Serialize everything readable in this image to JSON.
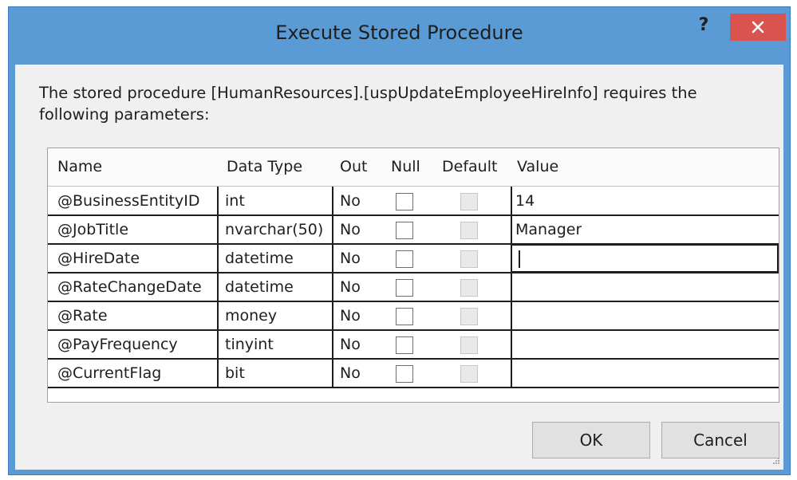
{
  "window": {
    "title": "Execute Stored Procedure",
    "help_label": "?",
    "accent_color": "#5b9bd5",
    "close_color": "#d9534f"
  },
  "description": "The stored procedure [HumanResources].[uspUpdateEmployeeHireInfo] requires the following parameters:",
  "grid": {
    "headers": {
      "name": "Name",
      "datatype": "Data Type",
      "out": "Out",
      "null": "Null",
      "default": "Default",
      "value": "Value"
    },
    "rows": [
      {
        "name": "@BusinessEntityID",
        "datatype": "int",
        "out": "No",
        "null_checked": false,
        "default_checked": false,
        "value": "14"
      },
      {
        "name": "@JobTitle",
        "datatype": "nvarchar(50)",
        "out": "No",
        "null_checked": false,
        "default_checked": false,
        "value": "Manager"
      },
      {
        "name": "@HireDate",
        "datatype": "datetime",
        "out": "No",
        "null_checked": false,
        "default_checked": false,
        "value": ""
      },
      {
        "name": "@RateChangeDate",
        "datatype": "datetime",
        "out": "No",
        "null_checked": false,
        "default_checked": false,
        "value": ""
      },
      {
        "name": "@Rate",
        "datatype": "money",
        "out": "No",
        "null_checked": false,
        "default_checked": false,
        "value": ""
      },
      {
        "name": "@PayFrequency",
        "datatype": "tinyint",
        "out": "No",
        "null_checked": false,
        "default_checked": false,
        "value": ""
      },
      {
        "name": "@CurrentFlag",
        "datatype": "bit",
        "out": "No",
        "null_checked": false,
        "default_checked": false,
        "value": ""
      }
    ]
  },
  "buttons": {
    "ok_label": "OK",
    "cancel_label": "Cancel"
  }
}
